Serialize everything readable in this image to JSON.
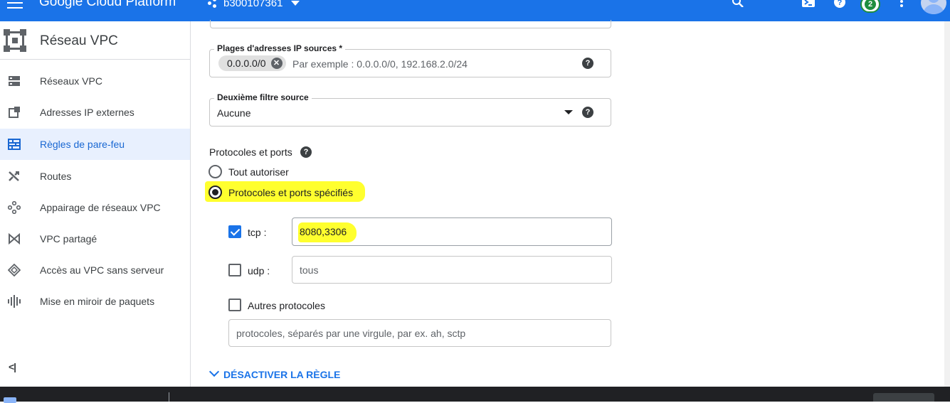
{
  "topbar": {
    "title": "Google Cloud Platform",
    "project": "b300107361",
    "notification_count": "2",
    "accent_color": "#1a73e8"
  },
  "sidebar": {
    "title": "Réseau VPC",
    "items": [
      {
        "label": "Réseaux VPC",
        "icon": "vpc-networks-icon"
      },
      {
        "label": "Adresses IP externes",
        "icon": "external-ip-icon"
      },
      {
        "label": "Règles de pare-feu",
        "icon": "firewall-icon",
        "active": true
      },
      {
        "label": "Routes",
        "icon": "routes-icon"
      },
      {
        "label": "Appairage de réseaux VPC",
        "icon": "peering-icon"
      },
      {
        "label": "VPC partagé",
        "icon": "shared-vpc-icon"
      },
      {
        "label": "Accès au VPC sans serveur",
        "icon": "serverless-icon"
      },
      {
        "label": "Mise en miroir de paquets",
        "icon": "packet-mirroring-icon"
      }
    ],
    "collapse_glyph": "<|"
  },
  "form": {
    "source_ip_ranges": {
      "label": "Plages d'adresses IP sources *",
      "chip": "0.0.0.0/0",
      "placeholder": "Par exemple : 0.0.0.0/0, 192.168.2.0/24"
    },
    "second_source_filter": {
      "label": "Deuxième filtre source",
      "value": "Aucune"
    },
    "protocols": {
      "title": "Protocoles et ports",
      "option_all": "Tout autoriser",
      "option_specified": "Protocoles et ports spécifiés",
      "selected": "specified",
      "tcp": {
        "label": "tcp :",
        "checked": true,
        "value": "8080,3306"
      },
      "udp": {
        "label": "udp :",
        "checked": false,
        "placeholder": "tous"
      },
      "other": {
        "label": "Autres protocoles",
        "checked": false,
        "placeholder": "protocoles, séparés par une virgule, par ex. ah, sctp"
      }
    },
    "disable_rule_link": "DÉSACTIVER LA RÈGLE",
    "highlight_color": "#ffff2e"
  }
}
